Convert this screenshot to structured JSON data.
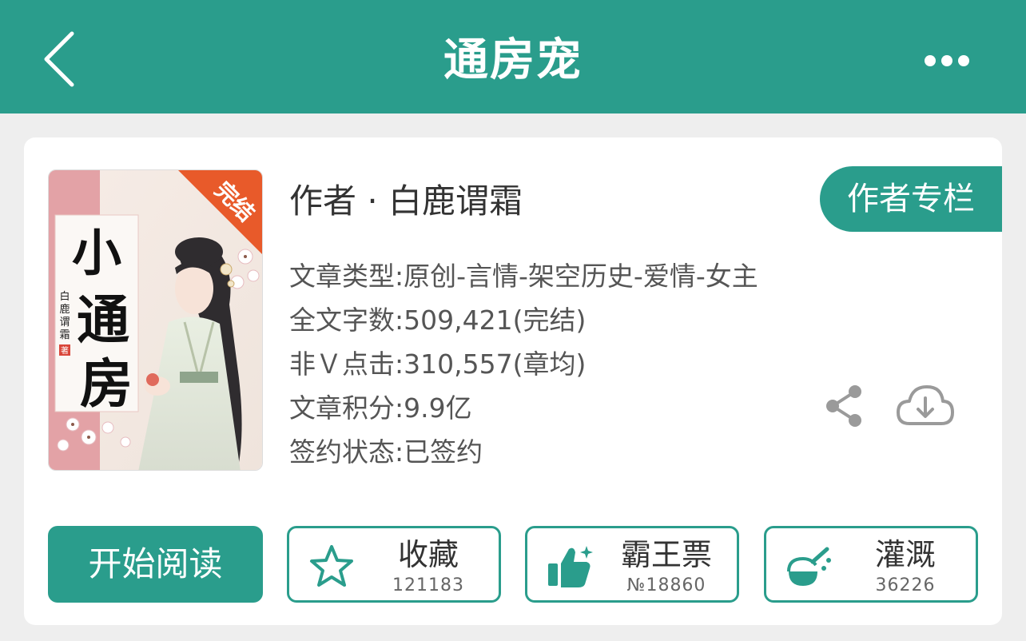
{
  "header": {
    "title": "通房宠",
    "back_icon": "chevron-left-icon",
    "more_icon": "more-horizontal-icon"
  },
  "cover": {
    "badge": "完结",
    "title_art": "小通房",
    "author_art": "白鹿谓霜",
    "author_seal": "著"
  },
  "book": {
    "author_line": "作者 · 白鹿谓霜",
    "author_column_label": "作者专栏",
    "info": {
      "type": "文章类型:原创-言情-架空历史-爱情-女主",
      "word_count": "全文字数:509,421(完结)",
      "clicks": "非Ｖ点击:310,557(章均)",
      "score": "文章积分:9.9亿",
      "sign_status": "签约状态:已签约"
    }
  },
  "actions": {
    "read_label": "开始阅读",
    "collect": {
      "label": "收藏",
      "count": "121183",
      "icon": "star-icon"
    },
    "vote": {
      "label": "霸王票",
      "count": "№18860",
      "icon": "thumbs-up-icon"
    },
    "irrigate": {
      "label": "灌溉",
      "count": "36226",
      "icon": "nutrient-flask-icon"
    }
  },
  "colors": {
    "accent": "#2a9d8c",
    "badge": "#e85a2a"
  }
}
